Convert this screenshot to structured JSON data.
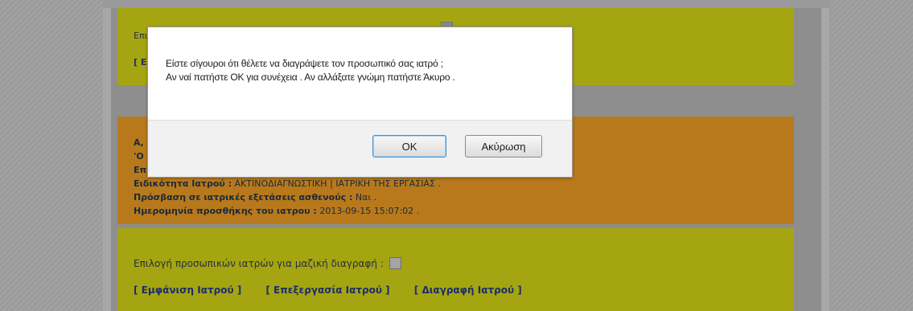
{
  "background": {
    "top_section": {
      "label_partial": "Επι",
      "link_partial": "[ Ε"
    },
    "doctor_details": {
      "line1_partial": "Α,",
      "line2_partial": "'Ο",
      "line3_partial": "Επ",
      "specialty_label": "Ειδικότητα Ιατρού :",
      "specialty_value": "ΑΚΤΙΝΟΔΙΑΓΝΩΣΤΙΚΗ | ΙΑΤΡΙΚΗ ΤΗΣ ΕΡΓΑΣΙΑΣ .",
      "access_label": "Πρόσβαση σε ιατρικές εξετάσεις ασθενούς :",
      "access_value": "Ναι .",
      "date_label": "Ημερομηνία προσθήκης του ιατρου :",
      "date_value": "2013-09-15 15:07:02 ."
    },
    "bulk_delete": {
      "label": "Επιλογή προσωπικών ιατρών για μαζική διαγραφή :",
      "links": {
        "view": "[ Εμφάνιση Ιατρού ]",
        "edit": "[ Επεξεργασία Ιατρού ]",
        "delete": "[ Διαγραφή Ιατρού ]"
      }
    }
  },
  "dialog": {
    "message_line1": "Είστε σίγουροι ότι θέλετε να διαγράψετε τον προσωπικό σας ιατρό ;",
    "message_line2": "Αν ναί πατήστε ΟΚ για συνέχεια . Αν αλλάξατε γνώμη πατήστε Άκυρο .",
    "ok_label": "OK",
    "cancel_label": "Ακύρωση"
  },
  "colors": {
    "yellow_block": "#a5a511",
    "orange_block": "#b8791c",
    "link_color": "#1c2e6a",
    "ok_focus_border": "#3f8fd0"
  }
}
